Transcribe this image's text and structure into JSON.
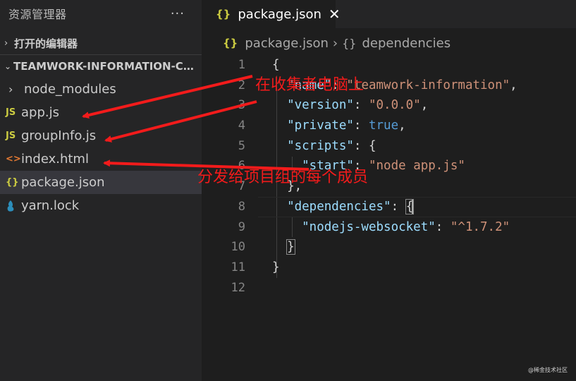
{
  "sidebar": {
    "title": "资源管理器",
    "more": "···",
    "open_editors": "打开的编辑器",
    "project": "TEAMWORK-INFORMATION-COL...",
    "items": [
      {
        "icon": "›",
        "label": "node_modules"
      },
      {
        "icon": "JS",
        "label": "app.js"
      },
      {
        "icon": "JS",
        "label": "groupInfo.js"
      },
      {
        "icon": "<>",
        "label": "index.html"
      },
      {
        "icon": "{}",
        "label": "package.json"
      },
      {
        "icon": "yarn",
        "label": "yarn.lock"
      }
    ]
  },
  "tab": {
    "icon": "{}",
    "label": "package.json",
    "close": "✕"
  },
  "breadcrumb": {
    "file_icon": "{}",
    "file": "package.json",
    "separator": "›",
    "node_icon": "{}",
    "node": "dependencies"
  },
  "code": {
    "line_numbers": [
      "1",
      "2",
      "3",
      "4",
      "5",
      "6",
      "7",
      "8",
      "9",
      "10",
      "11",
      "12"
    ],
    "lines": [
      "{",
      "  \"name\": \"teamwork-information\",",
      "  \"version\": \"0.0.0\",",
      "  \"private\": true,",
      "  \"scripts\": {",
      "    \"start\": \"node app.js\"",
      "  },",
      "  \"dependencies\": {",
      "    \"nodejs-websocket\": \"^1.7.2\"",
      "  }",
      "}",
      ""
    ]
  },
  "annotations": {
    "collector": "在收集者电脑上",
    "distribute": "分发给项目组的每个成员"
  },
  "watermark": "@稀金技术社区",
  "colors": {
    "annotation": "#f21b1b",
    "key": "#9cdcfe",
    "string": "#ce9178",
    "boolean": "#569cd6"
  }
}
